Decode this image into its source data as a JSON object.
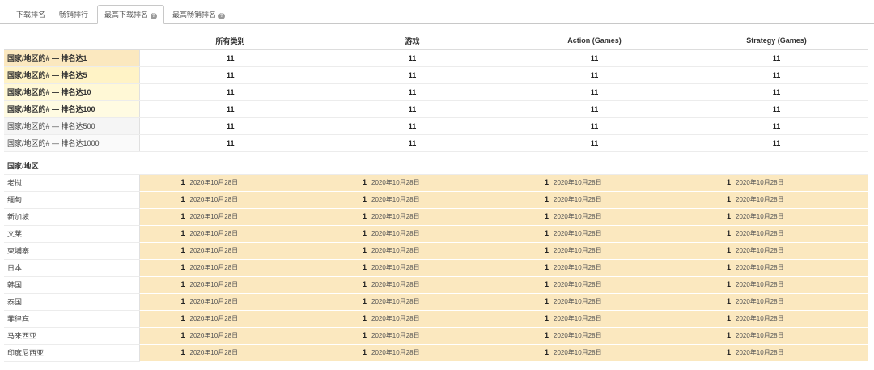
{
  "tabs": [
    {
      "label": "下载排名",
      "active": false
    },
    {
      "label": "畅销排行",
      "active": false
    },
    {
      "label": "最高下载排名",
      "active": true,
      "help": true
    },
    {
      "label": "最高畅销排名",
      "active": false,
      "help": true
    }
  ],
  "columns": [
    "所有类别",
    "游戏",
    "Action (Games)",
    "Strategy (Games)"
  ],
  "summary_rows": [
    {
      "label": "国家/地区的# — 排名达1",
      "values": [
        "11",
        "11",
        "11",
        "11"
      ],
      "bg": "#fbe8bf"
    },
    {
      "label": "国家/地区的# — 排名达5",
      "values": [
        "11",
        "11",
        "11",
        "11"
      ],
      "bg": "#fff3c6"
    },
    {
      "label": "国家/地区的# — 排名达10",
      "values": [
        "11",
        "11",
        "11",
        "11"
      ],
      "bg": "#fff8d6"
    },
    {
      "label": "国家/地区的# — 排名达100",
      "values": [
        "11",
        "11",
        "11",
        "11"
      ],
      "bg": "#fffbe2"
    },
    {
      "label": "国家/地区的# — 排名达500",
      "values": [
        "11",
        "11",
        "11",
        "11"
      ],
      "bg": "#f5f5f5"
    },
    {
      "label": "国家/地区的# — 排名达1000",
      "values": [
        "11",
        "11",
        "11",
        "11"
      ],
      "bg": "#fafafa"
    }
  ],
  "country_section_label": "国家/地区",
  "country_rows": [
    {
      "country": "老挝",
      "cells": [
        {
          "rank": "1",
          "date": "2020年10月28日"
        },
        {
          "rank": "1",
          "date": "2020年10月28日"
        },
        {
          "rank": "1",
          "date": "2020年10月28日"
        },
        {
          "rank": "1",
          "date": "2020年10月28日"
        }
      ]
    },
    {
      "country": "缅甸",
      "cells": [
        {
          "rank": "1",
          "date": "2020年10月28日"
        },
        {
          "rank": "1",
          "date": "2020年10月28日"
        },
        {
          "rank": "1",
          "date": "2020年10月28日"
        },
        {
          "rank": "1",
          "date": "2020年10月28日"
        }
      ]
    },
    {
      "country": "新加坡",
      "cells": [
        {
          "rank": "1",
          "date": "2020年10月28日"
        },
        {
          "rank": "1",
          "date": "2020年10月28日"
        },
        {
          "rank": "1",
          "date": "2020年10月28日"
        },
        {
          "rank": "1",
          "date": "2020年10月28日"
        }
      ]
    },
    {
      "country": "文莱",
      "cells": [
        {
          "rank": "1",
          "date": "2020年10月28日"
        },
        {
          "rank": "1",
          "date": "2020年10月28日"
        },
        {
          "rank": "1",
          "date": "2020年10月28日"
        },
        {
          "rank": "1",
          "date": "2020年10月28日"
        }
      ]
    },
    {
      "country": "柬埔寨",
      "cells": [
        {
          "rank": "1",
          "date": "2020年10月28日"
        },
        {
          "rank": "1",
          "date": "2020年10月28日"
        },
        {
          "rank": "1",
          "date": "2020年10月28日"
        },
        {
          "rank": "1",
          "date": "2020年10月28日"
        }
      ]
    },
    {
      "country": "日本",
      "cells": [
        {
          "rank": "1",
          "date": "2020年10月28日"
        },
        {
          "rank": "1",
          "date": "2020年10月28日"
        },
        {
          "rank": "1",
          "date": "2020年10月28日"
        },
        {
          "rank": "1",
          "date": "2020年10月28日"
        }
      ]
    },
    {
      "country": "韩国",
      "cells": [
        {
          "rank": "1",
          "date": "2020年10月28日"
        },
        {
          "rank": "1",
          "date": "2020年10月28日"
        },
        {
          "rank": "1",
          "date": "2020年10月28日"
        },
        {
          "rank": "1",
          "date": "2020年10月28日"
        }
      ]
    },
    {
      "country": "泰国",
      "cells": [
        {
          "rank": "1",
          "date": "2020年10月28日"
        },
        {
          "rank": "1",
          "date": "2020年10月28日"
        },
        {
          "rank": "1",
          "date": "2020年10月28日"
        },
        {
          "rank": "1",
          "date": "2020年10月28日"
        }
      ]
    },
    {
      "country": "菲律宾",
      "cells": [
        {
          "rank": "1",
          "date": "2020年10月28日"
        },
        {
          "rank": "1",
          "date": "2020年10月28日"
        },
        {
          "rank": "1",
          "date": "2020年10月28日"
        },
        {
          "rank": "1",
          "date": "2020年10月28日"
        }
      ]
    },
    {
      "country": "马来西亚",
      "cells": [
        {
          "rank": "1",
          "date": "2020年10月28日"
        },
        {
          "rank": "1",
          "date": "2020年10月28日"
        },
        {
          "rank": "1",
          "date": "2020年10月28日"
        },
        {
          "rank": "1",
          "date": "2020年10月28日"
        }
      ]
    },
    {
      "country": "印度尼西亚",
      "cells": [
        {
          "rank": "1",
          "date": "2020年10月28日"
        },
        {
          "rank": "1",
          "date": "2020年10月28日"
        },
        {
          "rank": "1",
          "date": "2020年10月28日"
        },
        {
          "rank": "1",
          "date": "2020年10月28日"
        }
      ]
    }
  ]
}
